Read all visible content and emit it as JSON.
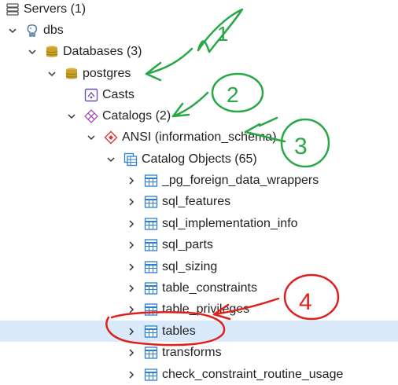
{
  "tree": {
    "servers": "Servers (1)",
    "dbs": "dbs",
    "databases": "Databases (3)",
    "postgres": "postgres",
    "casts": "Casts",
    "catalogs": "Catalogs (2)",
    "ansi": "ANSI (information_schema)",
    "catalog_objects": "Catalog Objects (65)",
    "tables": [
      "_pg_foreign_data_wrappers",
      "sql_features",
      "sql_implementation_info",
      "sql_parts",
      "sql_sizing",
      "table_constraints",
      "table_privileges",
      "tables",
      "transforms",
      "check_constraint_routine_usage"
    ]
  },
  "annotations": {
    "n1": "1",
    "n2": "2",
    "n3": "3",
    "n4": "4"
  },
  "colors": {
    "selected_row": "#dbeafa",
    "green_annotation": "#27a745",
    "red_annotation": "#e0201c",
    "db_icon": "#c9a227",
    "catalog_icon": "#a04fb0",
    "ansi_icon": "#d9383a",
    "table_icon": "#2f7fd0"
  },
  "icons": {
    "server": "server-icon",
    "elephant": "postgres-elephant-icon",
    "database": "database-icon",
    "cast": "cast-icon",
    "catalog": "catalog-icon",
    "ansi": "catalog-diamond-icon",
    "catalog_objects": "catalog-objects-icon",
    "table": "table-icon"
  }
}
